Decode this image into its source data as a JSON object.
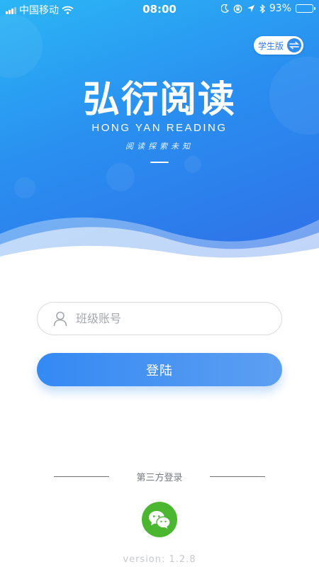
{
  "status_bar": {
    "carrier": "中国移动",
    "time": "08:00",
    "battery": "93%",
    "battery_level": 0.93,
    "icons": [
      "signal-icon",
      "wifi-icon",
      "moon-icon",
      "rotation-lock-icon",
      "location-icon",
      "bluetooth-icon",
      "battery-icon"
    ]
  },
  "role_switch": {
    "label": "学生版",
    "icon": "swap-icon"
  },
  "logo": {
    "title": "弘衍阅读",
    "subtitle": "HONG YAN READING",
    "slogan": "阅读探索未知"
  },
  "login_form": {
    "account_placeholder": "班级账号",
    "account_value": "",
    "login_label": "登陆"
  },
  "third_party": {
    "label": "第三方登录",
    "wechat_icon": "wechat-icon",
    "wechat_color": "#4bb62f"
  },
  "version": "version:  1.2.8",
  "colors": {
    "hero_start": "#2bb6f5",
    "hero_end": "#2f6fe8",
    "accent": "#3489f3"
  }
}
